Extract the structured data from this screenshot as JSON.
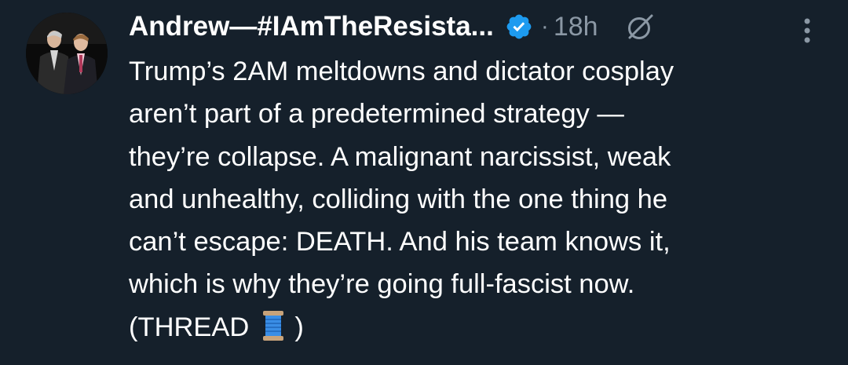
{
  "author": {
    "display_name": "Andrew—#IAmTheResista...",
    "verified": true,
    "avatar_icon": "profile-photo-two-men-in-suits"
  },
  "meta": {
    "separator": "·",
    "timestamp": "18h"
  },
  "icons": {
    "verified": "verified-badge-icon",
    "grok": "grok-icon",
    "more": "more-options-icon",
    "emoji": "spool-of-thread-emoji"
  },
  "colors": {
    "background": "#15202b",
    "text": "#ffffff",
    "muted": "#8b98a5",
    "verified": "#1d9bf0"
  },
  "tweet": {
    "lines": [
      "Trump’s 2AM meltdowns and dictator cosplay",
      "aren’t part of a predetermined strategy —",
      "they’re collapse. A malignant narcissist, weak",
      "and unhealthy, colliding with the one thing he",
      "can’t escape: DEATH. And his team knows it,",
      "which is why they’re going full-fascist now."
    ],
    "last_line_before": "(THREAD",
    "last_line_after": ")"
  }
}
